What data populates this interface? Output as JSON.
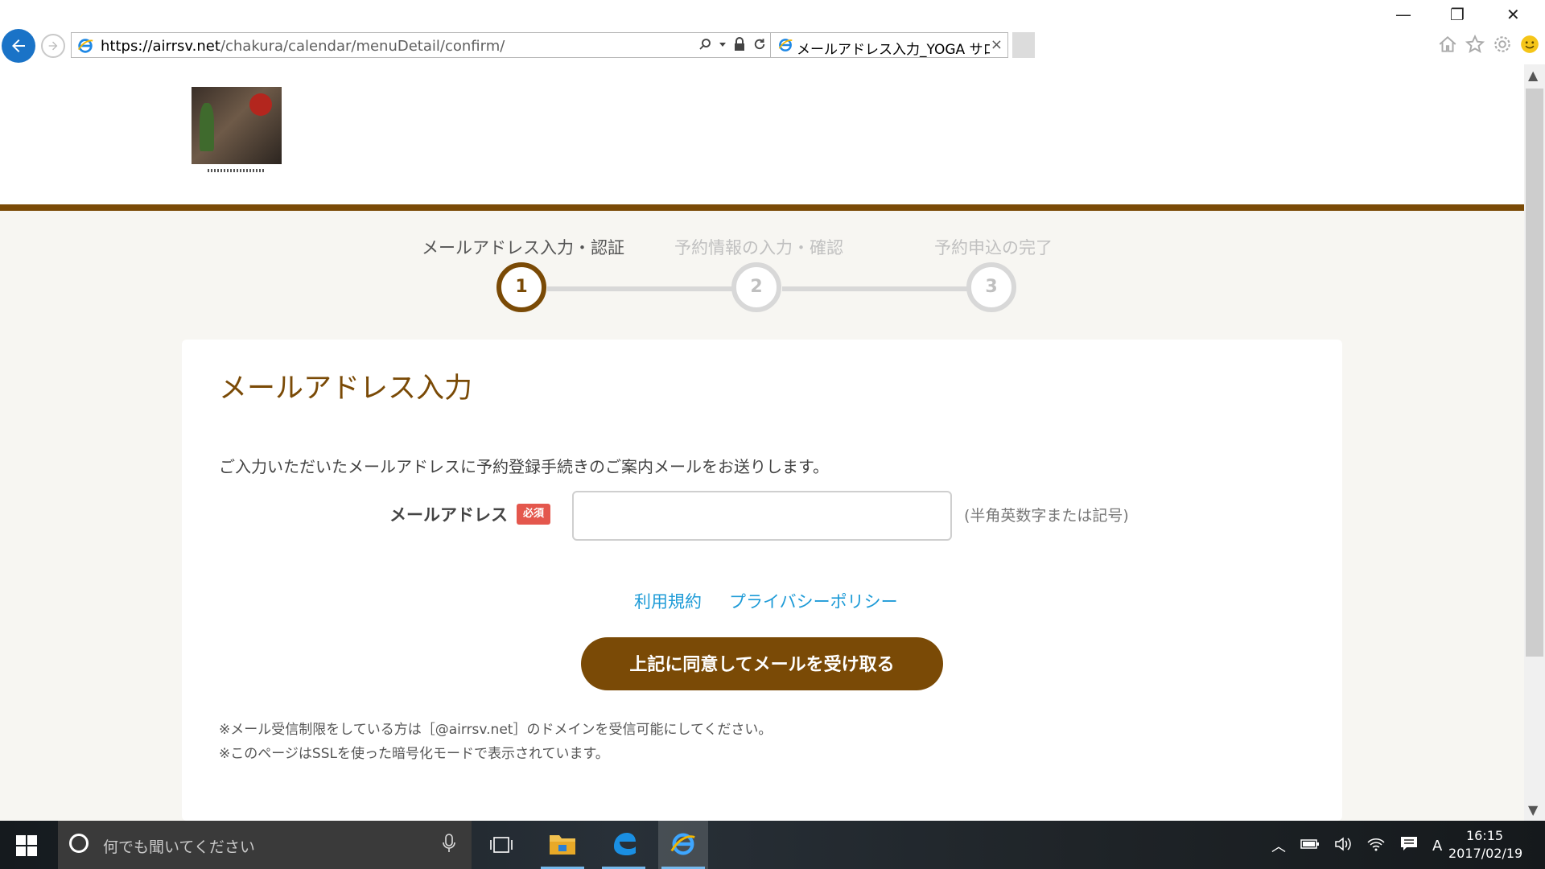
{
  "browser": {
    "url_prefix": "https://airrsv.net",
    "url_path": "/chakura/calendar/menuDetail/confirm/",
    "tab_title": "メールアドレス入力_YOGA サロン...",
    "tab_close": "×"
  },
  "window": {
    "minimize": "—",
    "restore": "❐",
    "close": "✕"
  },
  "steps": [
    {
      "label": "メールアドレス入力・認証",
      "number": "1",
      "active": true
    },
    {
      "label": "予約情報の入力・確認",
      "number": "2",
      "active": false
    },
    {
      "label": "予約申込の完了",
      "number": "3",
      "active": false
    }
  ],
  "form": {
    "title": "メールアドレス入力",
    "intro": "ご入力いただいたメールアドレスに予約登録手続きのご案内メールをお送りします。",
    "email_label": "メールアドレス",
    "required_badge": "必須",
    "email_value": "",
    "email_hint": "(半角英数字または記号)",
    "links": {
      "terms": "利用規約",
      "privacy": "プライバシーポリシー"
    },
    "submit_label": "上記に同意してメールを受け取る",
    "notes": [
      "※メール受信制限をしている方は［@airrsv.net］のドメインを受信可能にしてください。",
      "※このページはSSLを使った暗号化モードで表示されています。"
    ]
  },
  "taskbar": {
    "search_placeholder": "何でも聞いてください",
    "ime_indicator": "A",
    "time": "16:15",
    "date": "2017/02/19"
  },
  "colors": {
    "brand": "#7a4a06",
    "link": "#1e9bd7",
    "required": "#e4574d",
    "inactive_step": "#d8d8d8"
  },
  "icons": [
    "back-icon",
    "forward-icon",
    "ie-icon",
    "search-icon",
    "lock-icon",
    "refresh-icon",
    "home-icon",
    "star-icon",
    "gear-icon",
    "smiley-icon",
    "windows-icon",
    "microphone-icon",
    "task-view-icon",
    "folder-icon",
    "edge-icon",
    "wifi-icon",
    "volume-icon",
    "battery-icon",
    "notification-icon"
  ]
}
